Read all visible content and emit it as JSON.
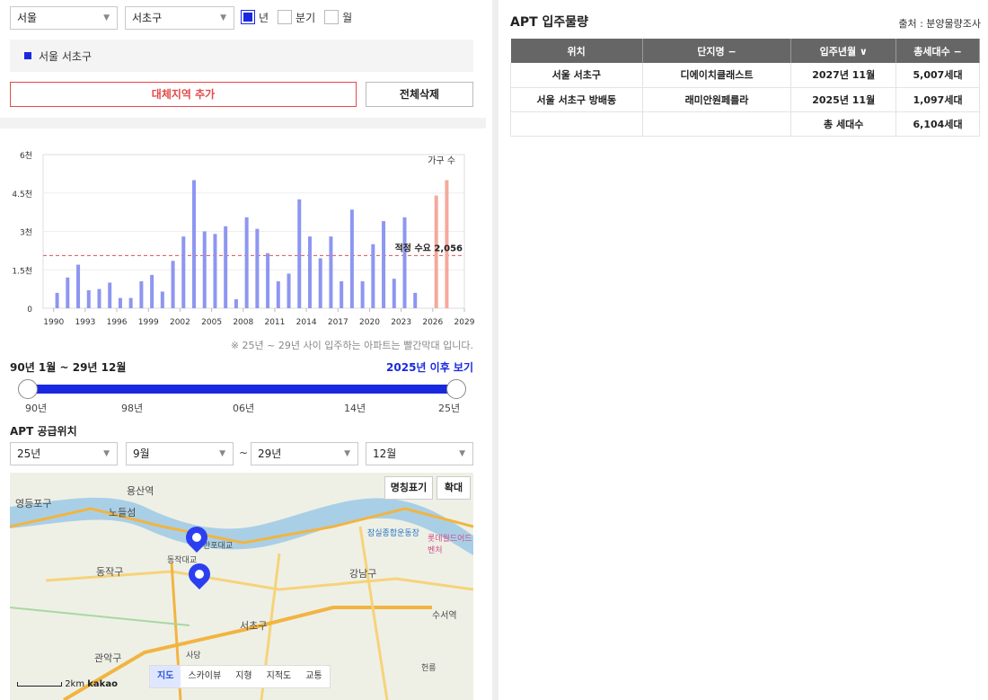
{
  "filters": {
    "city": "서울",
    "district": "서초구",
    "period_options": [
      {
        "label": "년",
        "checked": true
      },
      {
        "label": "분기",
        "checked": false
      },
      {
        "label": "월",
        "checked": false
      }
    ]
  },
  "selected_region": "서울 서초구",
  "buttons": {
    "add_region": "대체지역 추가",
    "delete_all": "전체삭제"
  },
  "chart_data": {
    "type": "bar",
    "legend": "가구 수",
    "y_ticks": [
      "6천",
      "4.5천",
      "3천",
      "1.5천",
      "0"
    ],
    "ylim": [
      0,
      6000
    ],
    "x_ticks": [
      "1990",
      "1993",
      "1996",
      "1999",
      "2002",
      "2005",
      "2008",
      "2011",
      "2014",
      "2017",
      "2020",
      "2023",
      "2026",
      "2029"
    ],
    "xlim": [
      1989,
      2029
    ],
    "reference": {
      "label": "적정 수요 2,056",
      "value": 2056
    },
    "colors": {
      "past": "#8d96f0",
      "future": "#f4a99c",
      "reference": "#e05050"
    },
    "years": [
      1990,
      1991,
      1992,
      1993,
      1994,
      1995,
      1996,
      1997,
      1998,
      1999,
      2000,
      2001,
      2002,
      2003,
      2004,
      2005,
      2006,
      2007,
      2008,
      2009,
      2010,
      2011,
      2012,
      2013,
      2014,
      2015,
      2016,
      2017,
      2018,
      2019,
      2020,
      2021,
      2022,
      2023,
      2024,
      2025,
      2026,
      2027
    ],
    "values": [
      600,
      1200,
      1700,
      700,
      750,
      1000,
      400,
      400,
      1050,
      1300,
      650,
      1850,
      2800,
      5000,
      3000,
      2900,
      3200,
      350,
      3550,
      3100,
      2150,
      1050,
      1350,
      4250,
      2800,
      1950,
      2800,
      1050,
      3850,
      1050,
      2500,
      3400,
      1150,
      3550,
      600,
      null,
      4400,
      5000
    ],
    "future_years": [
      2025,
      2026,
      2027
    ]
  },
  "chart_note": "※ 25년 ~ 29년 사이 입주하는 아파트는 빨간막대 입니다.",
  "range": {
    "title": "90년 1월 ~ 29년 12월",
    "link": "2025년 이후 보기",
    "ticks": [
      "90년",
      "98년",
      "06년",
      "14년",
      "25년"
    ]
  },
  "apt_location": {
    "title": "APT 공급위치",
    "from_year": "25년",
    "from_month": "9월",
    "tilde": "~",
    "to_year": "29년",
    "to_month": "12월"
  },
  "map": {
    "buttons": {
      "names": "명칭표기",
      "zoom": "확대"
    },
    "tabs": [
      "지도",
      "스카이뷰",
      "지형",
      "지적도",
      "교통"
    ],
    "active_tab": "지도",
    "labels": [
      "용산역",
      "노들섬",
      "영등포구",
      "동작대교",
      "반포대교",
      "동작구",
      "강남구",
      "서초구",
      "관악구",
      "수서역",
      "잠실종합운동장",
      "롯데월드어드벤처",
      "사당",
      "헌릉"
    ],
    "scale": "2km",
    "brand": "kakao"
  },
  "supply": {
    "title": "APT 입주물량",
    "source": "출처 : 분양물량조사",
    "headers": [
      "위치",
      "단지명 −",
      "입주년월 ∨",
      "총세대수 −"
    ],
    "rows": [
      [
        "서울 서초구",
        "디에이치클래스트",
        "2027년 11월",
        "5,007세대"
      ],
      [
        "서울 서초구 방배동",
        "래미안원페를라",
        "2025년 11월",
        "1,097세대"
      ],
      [
        "",
        "",
        "총 세대수",
        "6,104세대"
      ]
    ]
  }
}
